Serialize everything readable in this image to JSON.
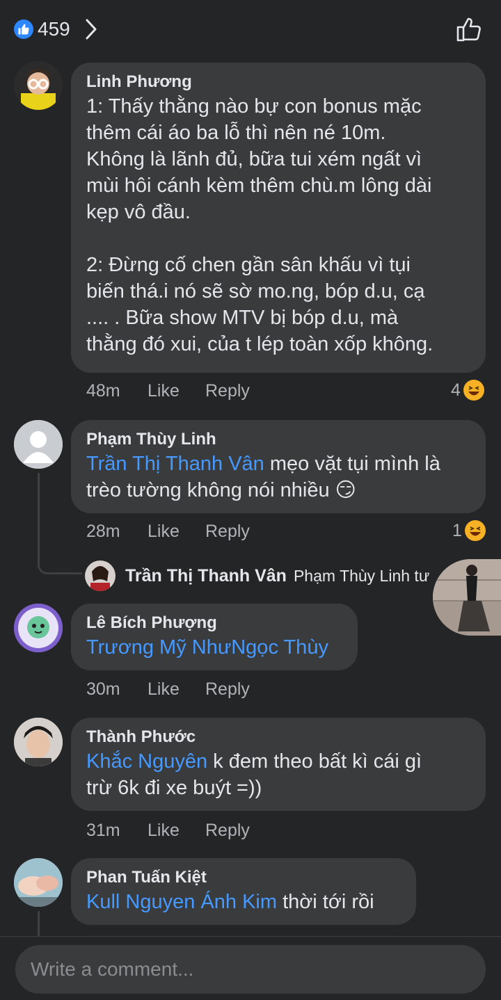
{
  "header": {
    "like_count": "459"
  },
  "comments": [
    {
      "author": "Linh Phương",
      "text": "1: Thấy thằng nào bự con bonus mặc\nthêm cái áo ba lỗ thì nên né 10m.\nKhông là lãnh đủ, bữa tui xém ngất vì\nmùi hôi cánh kèm thêm chù.m lông dài\nkẹp vô đầu.\n\n2: Đừng cố chen gần sân khấu vì tụi\nbiến thá.i nó sẽ sờ mo.ng, bóp d.u, cạ\n.... . Bữa show MTV bị bóp d.u, mà\nthằng đó xui, của t lép toàn xốp không.",
      "time": "48m",
      "like": "Like",
      "reply": "Reply",
      "reactions": "4"
    },
    {
      "author": "Phạm Thùy Linh",
      "mention": "Trần Thị Thanh Vân",
      "text": " mẹo vặt tụi mình là\ntrèo tường không nói nhiều 😏",
      "time": "28m",
      "like": "Like",
      "reply": "Reply",
      "reactions": "1",
      "reply_preview": {
        "author": "Trần Thị Thanh Vân",
        "text": "Phạm Thùy Linh  tư"
      }
    },
    {
      "author": "Lê Bích Phượng",
      "mention": "Trương Mỹ NhưNgọc Thùy",
      "text": "",
      "time": "30m",
      "like": "Like",
      "reply": "Reply"
    },
    {
      "author": "Thành Phước",
      "mention": "Khắc Nguyên",
      "text": " k đem theo bất kì cái gì\ntrừ 6k đi xe buýt =))",
      "time": "31m",
      "like": "Like",
      "reply": "Reply"
    },
    {
      "author": "Phan Tuấn Kiệt",
      "mention": "Kull Nguyen Ánh Kim",
      "text": " thời tới rồi"
    }
  ],
  "composer": {
    "placeholder": "Write a comment..."
  }
}
